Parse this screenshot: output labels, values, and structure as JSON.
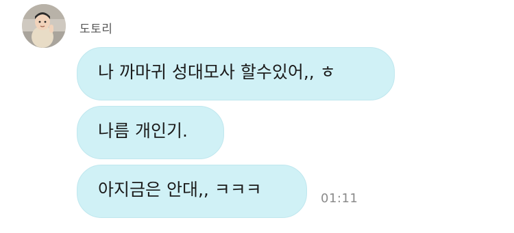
{
  "chat": {
    "sender_name": "도토리",
    "messages": [
      {
        "text": "나 까마귀 성대모사 할수있어,, ㅎ"
      },
      {
        "text": "나름 개인기."
      },
      {
        "text": "아지금은 안대,, ㅋㅋㅋ",
        "time": "01:11"
      }
    ]
  },
  "colors": {
    "bubble_bg": "#d0f1f6",
    "timestamp": "#8a8a8a",
    "sender_name": "#555555"
  }
}
